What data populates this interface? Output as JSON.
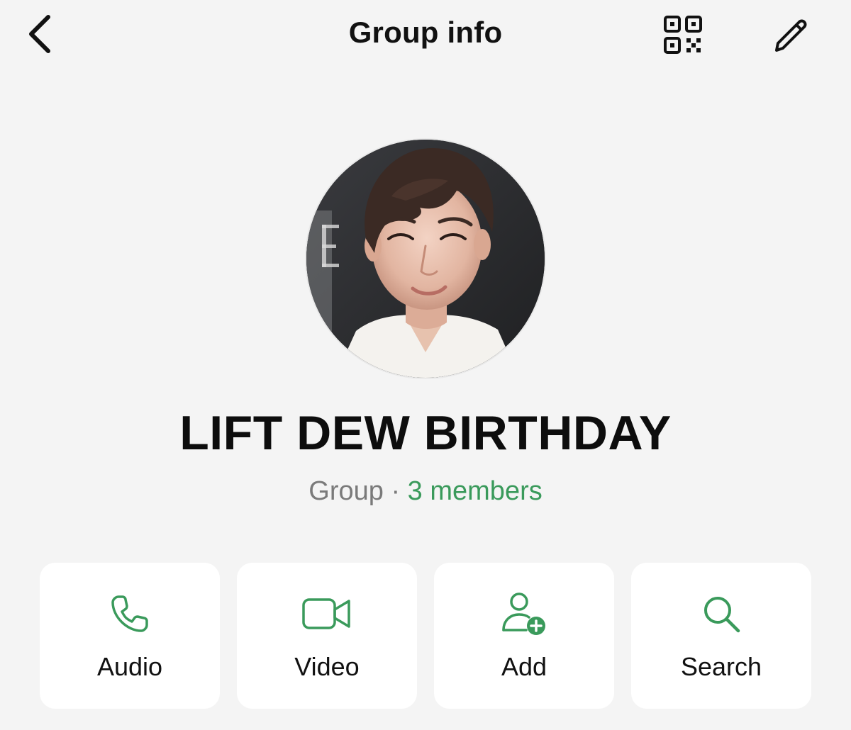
{
  "header": {
    "title": "Group info",
    "back_icon": "chevron-left-icon",
    "qr_icon": "qr-code-icon",
    "edit_icon": "pencil-icon"
  },
  "group": {
    "name": "LIFT DEW BIRTHDAY",
    "type_label": "Group",
    "separator": " · ",
    "members_label": "3 members"
  },
  "actions": [
    {
      "label": "Audio",
      "icon": "phone-icon"
    },
    {
      "label": "Video",
      "icon": "video-camera-icon"
    },
    {
      "label": "Add",
      "icon": "add-person-icon"
    },
    {
      "label": "Search",
      "icon": "search-icon"
    }
  ],
  "colors": {
    "accent": "#3a9a5b",
    "background": "#f4f4f4",
    "card": "#ffffff",
    "muted_text": "#7a7a7a"
  }
}
